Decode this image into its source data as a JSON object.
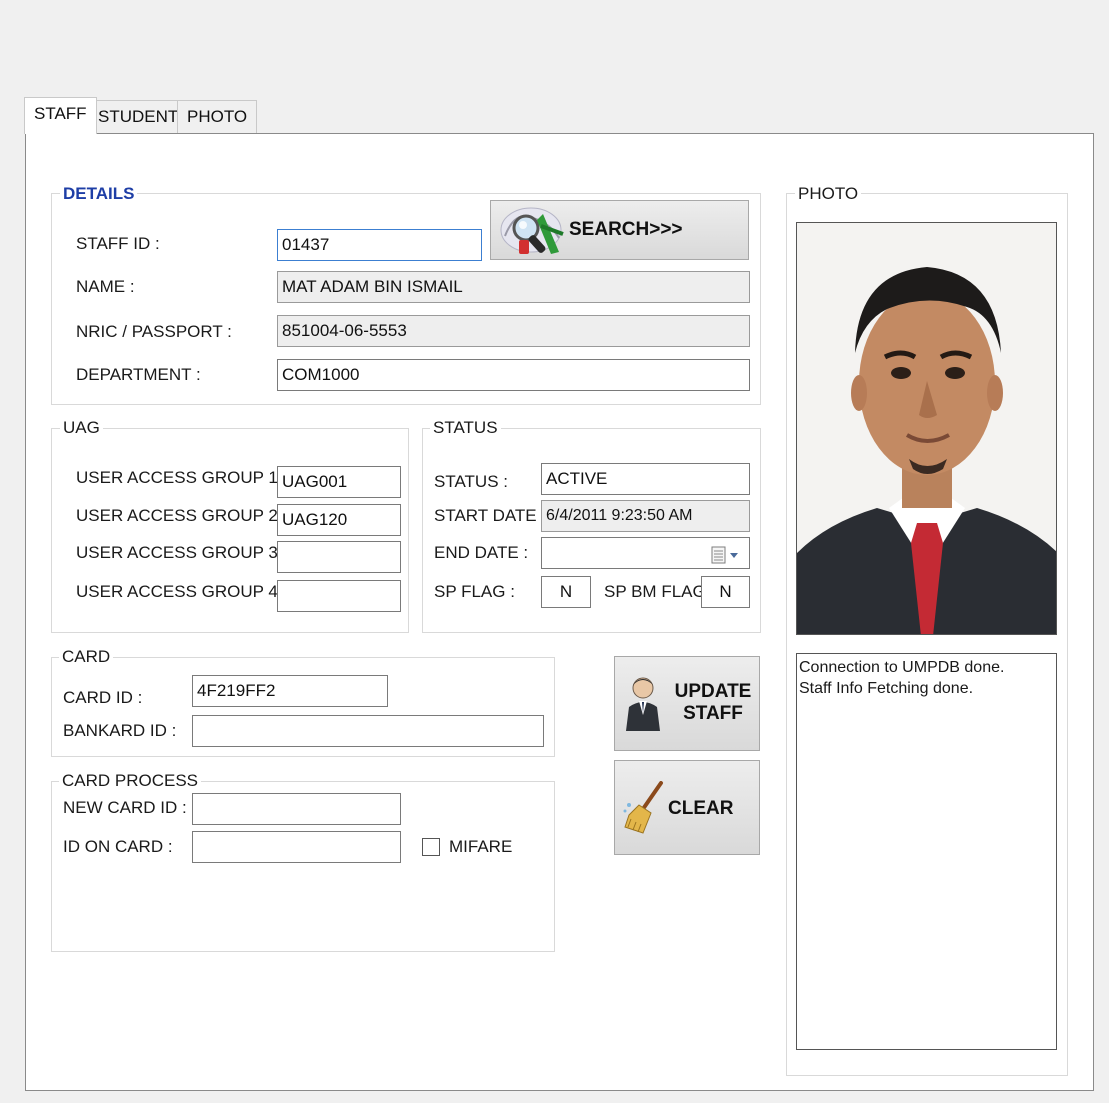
{
  "tabs": [
    "STAFF",
    "STUDENT",
    "PHOTO"
  ],
  "details": {
    "legend": "DETAILS",
    "staff_id_label": "STAFF ID :",
    "staff_id": "01437",
    "search_label": "SEARCH>>>",
    "name_label": "NAME :",
    "name": "MAT ADAM BIN ISMAIL",
    "nric_label": "NRIC / PASSPORT :",
    "nric": "851004-06-5553",
    "department_label": "DEPARTMENT :",
    "department": "COM1000"
  },
  "uag": {
    "legend": "UAG",
    "groups": [
      {
        "label": "USER ACCESS GROUP 1 :",
        "value": "UAG001"
      },
      {
        "label": "USER ACCESS GROUP 2 :",
        "value": "UAG120"
      },
      {
        "label": "USER ACCESS GROUP 3 :",
        "value": ""
      },
      {
        "label": "USER ACCESS GROUP 4 :",
        "value": ""
      }
    ]
  },
  "status": {
    "legend": "STATUS",
    "status_label": "STATUS :",
    "status": "ACTIVE",
    "start_date_label": "START DATE :",
    "start_date": "6/4/2011 9:23:50 AM",
    "end_date_label": "END DATE :",
    "end_date": "",
    "sp_flag_label": "SP FLAG :",
    "sp_flag": "N",
    "sp_bm_flag_label": "SP BM FLAG:",
    "sp_bm_flag": "N"
  },
  "card": {
    "legend": "CARD",
    "card_id_label": "CARD ID :",
    "card_id": "4F219FF2",
    "bankard_id_label": "BANKARD ID :",
    "bankard_id": ""
  },
  "card_process": {
    "legend": "CARD PROCESS",
    "new_card_id_label": "NEW CARD ID :",
    "new_card_id": "",
    "id_on_card_label": "ID ON CARD :",
    "id_on_card": "",
    "mifare_label": "MIFARE",
    "mifare_checked": false
  },
  "actions": {
    "update_line1": "UPDATE",
    "update_line2": "STAFF",
    "clear_label": "CLEAR"
  },
  "photo": {
    "legend": "PHOTO"
  },
  "log": {
    "lines": [
      "Connection to UMPDB done.",
      "Staff Info Fetching done."
    ]
  },
  "icons": {
    "search": "search-magnifier-icon",
    "update": "user-update-icon",
    "clear": "broom-icon",
    "calendar": "calendar-dropdown-icon"
  },
  "colors": {
    "accent_legend": "#1e3ea6",
    "focus_border": "#3c7fd1"
  }
}
